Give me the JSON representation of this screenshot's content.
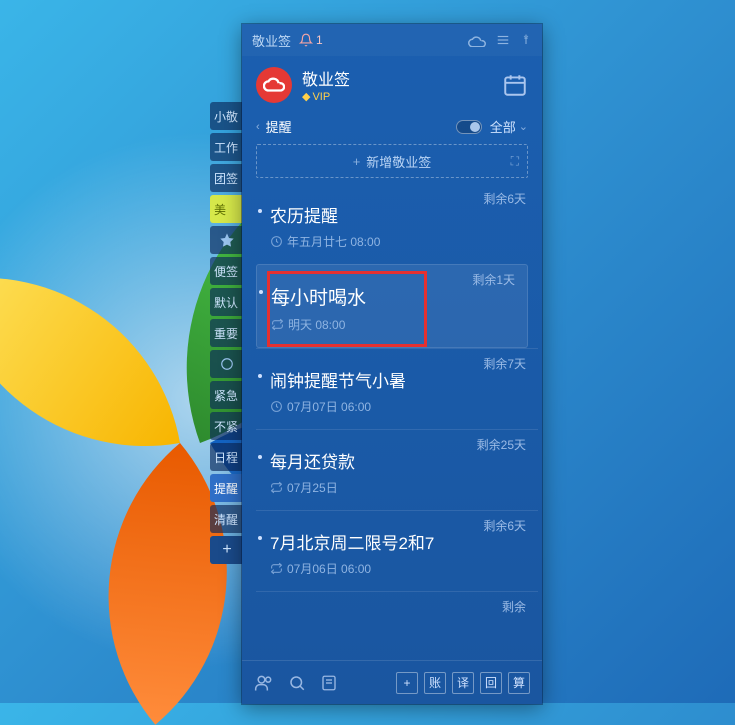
{
  "titlebar": {
    "appname": "敬业签",
    "notif_count": "1"
  },
  "header": {
    "title": "敬业签",
    "vip": "VIP"
  },
  "tabs": {
    "current": "提醒",
    "filter_label": "全部"
  },
  "addbar": {
    "label": "新增敬业签"
  },
  "sidebar": {
    "items": [
      "小敬",
      "工作",
      "团签",
      "美",
      "",
      "便签",
      "默认",
      "重要",
      "",
      "紧急",
      "不紧",
      "日程",
      "提醒",
      "清醒"
    ],
    "add": "+"
  },
  "reminders": [
    {
      "remain": "剩余6天",
      "title": "农历提醒",
      "sub": "年五月廿七 08:00",
      "icon": "clock"
    },
    {
      "remain": "剩余1天",
      "title": "每小时喝水",
      "sub": "明天 08:00",
      "icon": "repeat",
      "selected": true,
      "highlighted": true
    },
    {
      "remain": "剩余7天",
      "title": "闹钟提醒节气小暑",
      "sub": "07月07日 06:00",
      "icon": "clock"
    },
    {
      "remain": "剩余25天",
      "title": "每月还贷款",
      "sub": "07月25日",
      "icon": "repeat"
    },
    {
      "remain": "剩余6天",
      "title": "7月北京周二限号2和7",
      "sub": "07月06日 06:00",
      "icon": "repeat"
    }
  ],
  "partial_remain": "剩余",
  "bottombar": {
    "buttons": [
      "+",
      "账",
      "译",
      "回",
      "算"
    ]
  }
}
